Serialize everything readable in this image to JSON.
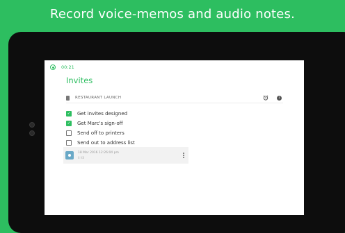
{
  "headline": "Record voice-memos and audio notes.",
  "recording": {
    "time": "00:21"
  },
  "note": {
    "title": "Invites",
    "notebook": "RESTAURANT LAUNCH",
    "checklist": [
      {
        "text": "Get invites designed",
        "checked": true
      },
      {
        "text": "Get Marc's sign-off",
        "checked": true
      },
      {
        "text": "Send off to printers",
        "checked": false
      },
      {
        "text": "Send out to address list",
        "checked": false
      }
    ],
    "attachment": {
      "date": "18 Mar 2016 12:26:04 pm",
      "size": "8 KB"
    }
  },
  "colors": {
    "brand_green": "#2dbe60",
    "device": "#0d0d0d"
  }
}
